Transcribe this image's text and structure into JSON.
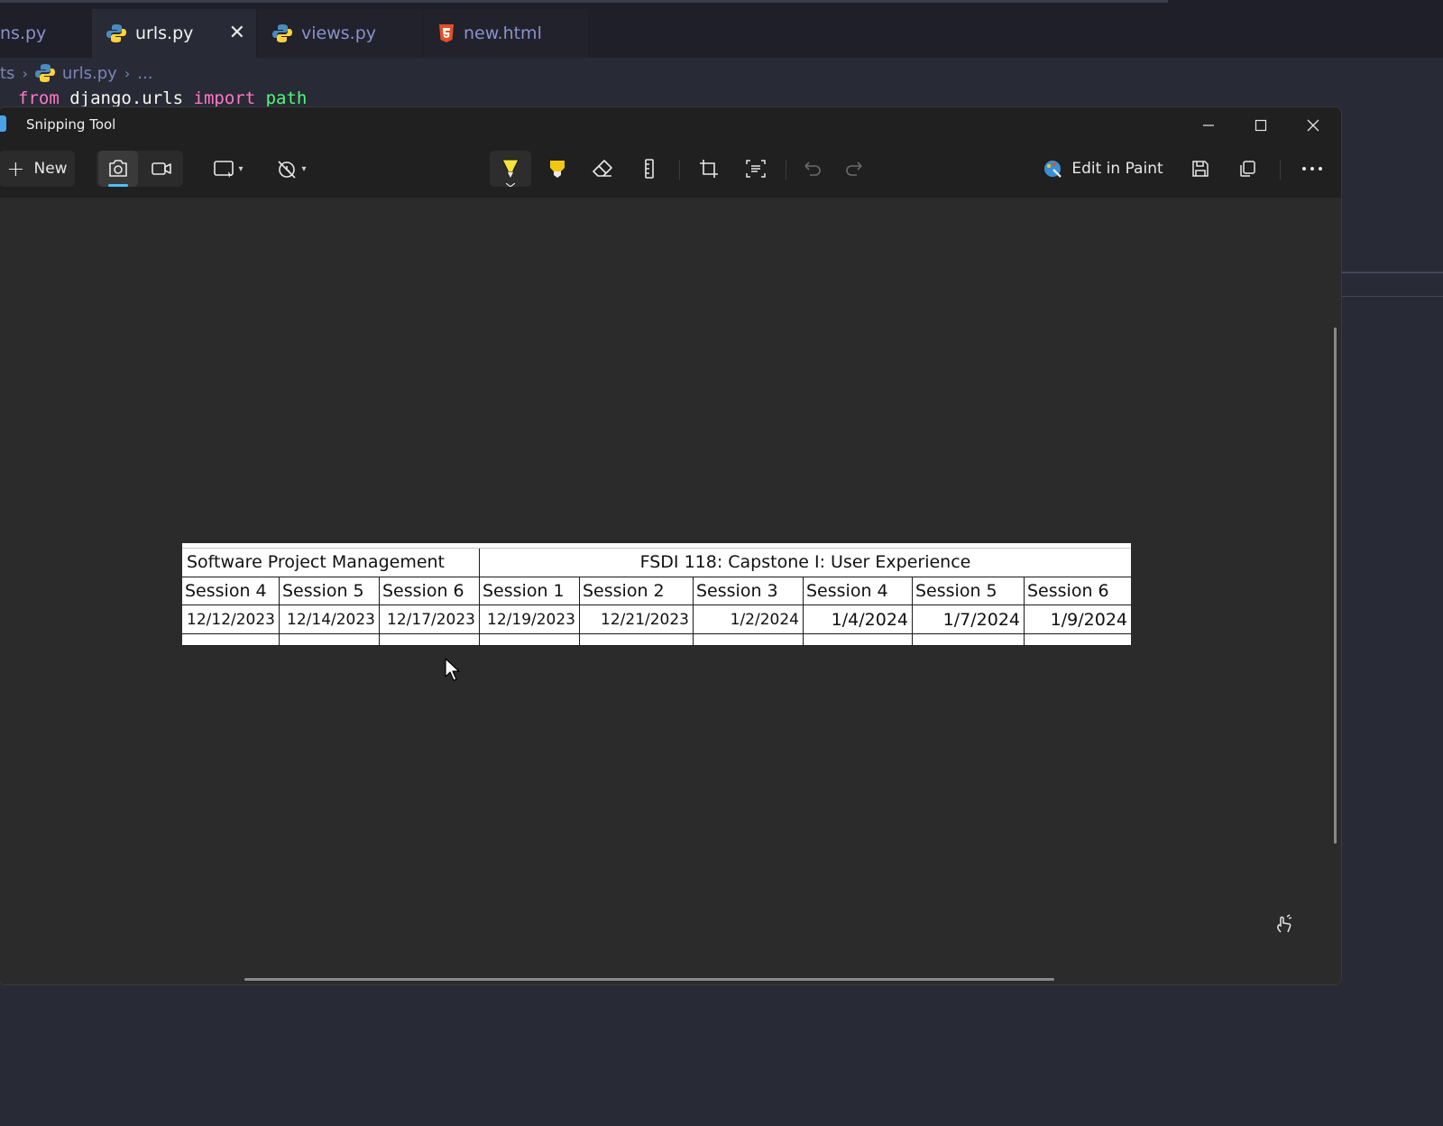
{
  "vscode": {
    "tabs": [
      {
        "label": "ns.py"
      },
      {
        "label": "urls.py"
      },
      {
        "label": "views.py"
      },
      {
        "label": "new.html"
      }
    ],
    "close_glyph": "✕",
    "breadcrumb": {
      "prefix": "ts",
      "file": "urls.py",
      "ellipsis": "..."
    },
    "code": {
      "kw1": "from",
      "module": "django.urls",
      "kw2": "import",
      "name": "path"
    }
  },
  "snip": {
    "title": "Snipping Tool",
    "new_label": "New",
    "paint_label": "Edit in Paint",
    "icons": [
      "camera-icon",
      "video-icon",
      "rectangle-snip-icon",
      "no-delay-icon",
      "ballpoint-pen-icon",
      "highlighter-icon",
      "eraser-icon",
      "ruler-icon",
      "crop-icon",
      "text-actions-icon",
      "undo-icon",
      "redo-icon",
      "paint-icon",
      "save-icon",
      "copy-icon",
      "more-icon",
      "touch-writing-icon"
    ],
    "colors": {
      "pen": "#f5e23a",
      "highlighter": "#f2c811",
      "accent": "#4cc2ff"
    }
  },
  "captured": {
    "header_left": "Software Project Management",
    "header_right": "FSDI 118: Capstone I: User Experience",
    "sessions": [
      "Session 4",
      "Session 5",
      "Session 6",
      "Session 1",
      "Session 2",
      "Session 3",
      "Session 4",
      "Session 5",
      "Session 6"
    ],
    "dates": [
      "12/12/2023",
      "12/14/2023",
      "12/17/2023",
      "12/19/2023",
      "12/21/2023",
      "1/2/2024",
      "1/4/2024",
      "1/7/2024",
      "1/9/2024"
    ]
  }
}
